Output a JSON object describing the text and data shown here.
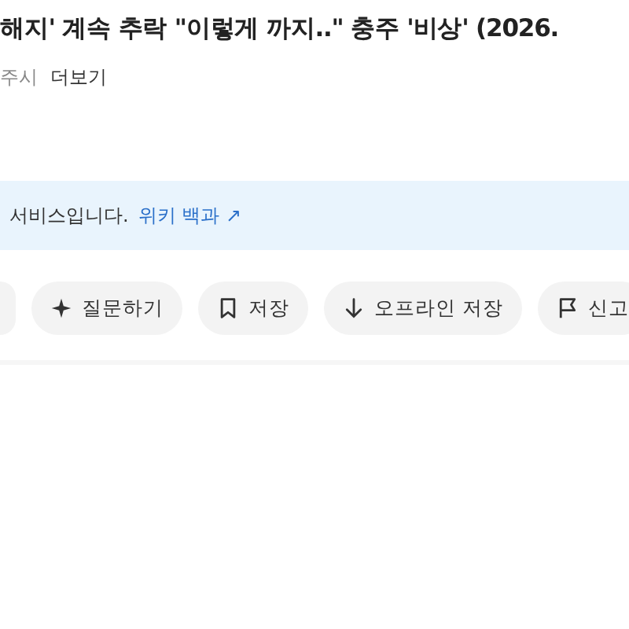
{
  "headline": {
    "title": "해지' 계속 추락 \"이렇게 까지..\" 충주 '비상' (2026.",
    "source": "주시",
    "more": "더보기"
  },
  "notice": {
    "text": "서비스입니다.",
    "link": "위키 백과 ↗"
  },
  "actions": [
    {
      "kind": "blank"
    },
    {
      "kind": "ask",
      "label": "질문하기"
    },
    {
      "kind": "save",
      "label": "저장"
    },
    {
      "kind": "download",
      "label": "오프라인 저장"
    },
    {
      "kind": "report",
      "label": "신고"
    }
  ]
}
